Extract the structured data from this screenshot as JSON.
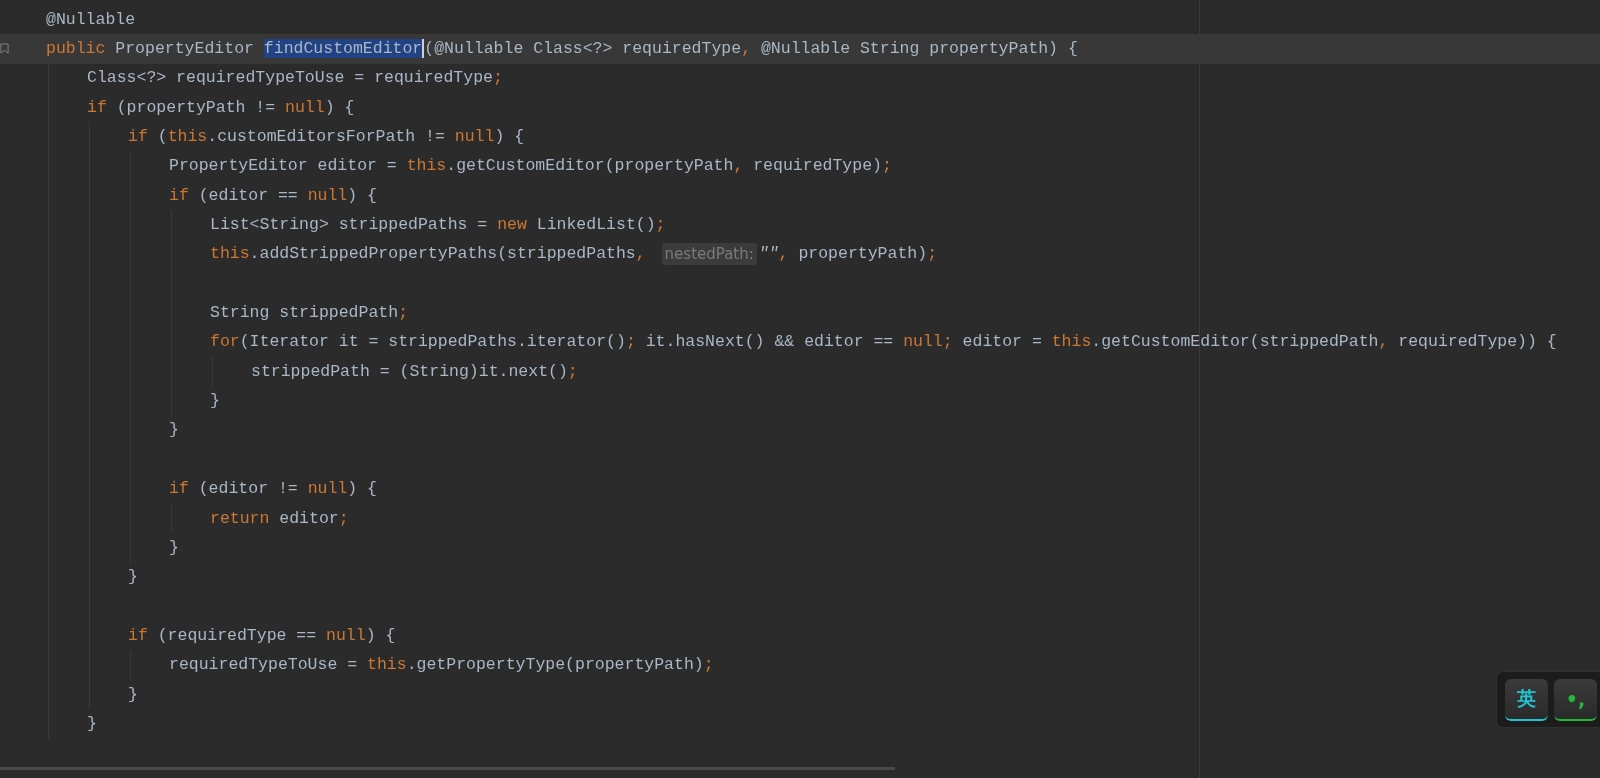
{
  "editor": {
    "lines": [
      {
        "kind": "code",
        "current": false,
        "marker": false,
        "segs": [
          {
            "t": "@Nullable",
            "kind": "plain"
          }
        ]
      },
      {
        "kind": "code",
        "current": true,
        "marker": true,
        "segs": [
          {
            "t": "public ",
            "kind": "kw"
          },
          {
            "t": "PropertyEditor ",
            "kind": "plain"
          },
          {
            "t": "findCustomEditor",
            "kind": "sel"
          },
          {
            "t": "(@Nullable Class<?> requiredType",
            "kind": "plain"
          },
          {
            "t": ", ",
            "kind": "kw"
          },
          {
            "t": "@Nullable String propertyPath) {",
            "kind": "plain"
          }
        ],
        "children": [
          {
            "kind": "code",
            "current": false,
            "marker": false,
            "segs": [
              {
                "t": "Class<?> requiredTypeToUse = requiredType",
                "kind": "plain"
              },
              {
                "t": ";",
                "kind": "kw"
              }
            ]
          },
          {
            "kind": "code",
            "current": false,
            "marker": false,
            "segs": [
              {
                "t": "if ",
                "kind": "kw"
              },
              {
                "t": "(propertyPath != ",
                "kind": "plain"
              },
              {
                "t": "null",
                "kind": "kw"
              },
              {
                "t": ") {",
                "kind": "plain"
              }
            ],
            "children": [
              {
                "kind": "code",
                "current": false,
                "marker": false,
                "segs": [
                  {
                    "t": "if ",
                    "kind": "kw"
                  },
                  {
                    "t": "(",
                    "kind": "plain"
                  },
                  {
                    "t": "this",
                    "kind": "kw"
                  },
                  {
                    "t": ".customEditorsForPath != ",
                    "kind": "plain"
                  },
                  {
                    "t": "null",
                    "kind": "kw"
                  },
                  {
                    "t": ") {",
                    "kind": "plain"
                  }
                ],
                "children": [
                  {
                    "kind": "code",
                    "current": false,
                    "marker": false,
                    "segs": [
                      {
                        "t": "PropertyEditor editor = ",
                        "kind": "plain"
                      },
                      {
                        "t": "this",
                        "kind": "kw"
                      },
                      {
                        "t": ".getCustomEditor(propertyPath",
                        "kind": "plain"
                      },
                      {
                        "t": ", ",
                        "kind": "kw"
                      },
                      {
                        "t": "requiredType)",
                        "kind": "plain"
                      },
                      {
                        "t": ";",
                        "kind": "kw"
                      }
                    ]
                  },
                  {
                    "kind": "code",
                    "current": false,
                    "marker": false,
                    "segs": [
                      {
                        "t": "if ",
                        "kind": "kw"
                      },
                      {
                        "t": "(editor == ",
                        "kind": "plain"
                      },
                      {
                        "t": "null",
                        "kind": "kw"
                      },
                      {
                        "t": ") {",
                        "kind": "plain"
                      }
                    ],
                    "children": [
                      {
                        "kind": "code",
                        "current": false,
                        "marker": false,
                        "segs": [
                          {
                            "t": "List<String> strippedPaths = ",
                            "kind": "plain"
                          },
                          {
                            "t": "new ",
                            "kind": "kw"
                          },
                          {
                            "t": "LinkedList()",
                            "kind": "plain"
                          },
                          {
                            "t": ";",
                            "kind": "kw"
                          }
                        ]
                      },
                      {
                        "kind": "code",
                        "current": false,
                        "marker": false,
                        "segs": [
                          {
                            "t": "this",
                            "kind": "kw"
                          },
                          {
                            "t": ".addStrippedPropertyPaths(strippedPaths",
                            "kind": "plain"
                          },
                          {
                            "t": ", ",
                            "kind": "kw"
                          },
                          {
                            "t": "nestedPath:",
                            "kind": "hint"
                          },
                          {
                            "t": "\"\"",
                            "kind": "str"
                          },
                          {
                            "t": ", ",
                            "kind": "kw"
                          },
                          {
                            "t": "propertyPath)",
                            "kind": "plain"
                          },
                          {
                            "t": ";",
                            "kind": "kw"
                          }
                        ]
                      },
                      {
                        "kind": "blank"
                      },
                      {
                        "kind": "code",
                        "current": false,
                        "marker": false,
                        "segs": [
                          {
                            "t": "String strippedPath",
                            "kind": "plain"
                          },
                          {
                            "t": ";",
                            "kind": "kw"
                          }
                        ]
                      },
                      {
                        "kind": "code",
                        "current": false,
                        "marker": false,
                        "segs": [
                          {
                            "t": "for",
                            "kind": "kw"
                          },
                          {
                            "t": "(Iterator it = strippedPaths.iterator()",
                            "kind": "plain"
                          },
                          {
                            "t": "; ",
                            "kind": "kw"
                          },
                          {
                            "t": "it.hasNext() && editor == ",
                            "kind": "plain"
                          },
                          {
                            "t": "null",
                            "kind": "kw"
                          },
                          {
                            "t": "; ",
                            "kind": "kw"
                          },
                          {
                            "t": "editor = ",
                            "kind": "plain"
                          },
                          {
                            "t": "this",
                            "kind": "kw"
                          },
                          {
                            "t": ".getCustomEditor(strippedPath",
                            "kind": "plain"
                          },
                          {
                            "t": ", ",
                            "kind": "kw"
                          },
                          {
                            "t": "requiredType)) {",
                            "kind": "plain"
                          }
                        ],
                        "children": [
                          {
                            "kind": "code",
                            "current": false,
                            "marker": false,
                            "segs": [
                              {
                                "t": "strippedPath = (String)it.next()",
                                "kind": "plain"
                              },
                              {
                                "t": ";",
                                "kind": "kw"
                              }
                            ]
                          }
                        ]
                      },
                      {
                        "kind": "code",
                        "current": false,
                        "marker": false,
                        "segs": [
                          {
                            "t": "}",
                            "kind": "plain"
                          }
                        ]
                      }
                    ]
                  },
                  {
                    "kind": "code",
                    "current": false,
                    "marker": false,
                    "segs": [
                      {
                        "t": "}",
                        "kind": "plain"
                      }
                    ]
                  },
                  {
                    "kind": "blank"
                  },
                  {
                    "kind": "code",
                    "current": false,
                    "marker": false,
                    "segs": [
                      {
                        "t": "if ",
                        "kind": "kw"
                      },
                      {
                        "t": "(editor != ",
                        "kind": "plain"
                      },
                      {
                        "t": "null",
                        "kind": "kw"
                      },
                      {
                        "t": ") {",
                        "kind": "plain"
                      }
                    ],
                    "children": [
                      {
                        "kind": "code",
                        "current": false,
                        "marker": false,
                        "segs": [
                          {
                            "t": "return ",
                            "kind": "kw"
                          },
                          {
                            "t": "editor",
                            "kind": "plain"
                          },
                          {
                            "t": ";",
                            "kind": "kw"
                          }
                        ]
                      }
                    ]
                  },
                  {
                    "kind": "code",
                    "current": false,
                    "marker": false,
                    "segs": [
                      {
                        "t": "}",
                        "kind": "plain"
                      }
                    ]
                  }
                ]
              },
              {
                "kind": "code",
                "current": false,
                "marker": false,
                "segs": [
                  {
                    "t": "}",
                    "kind": "plain"
                  }
                ]
              },
              {
                "kind": "blank"
              },
              {
                "kind": "code",
                "current": false,
                "marker": false,
                "segs": [
                  {
                    "t": "if ",
                    "kind": "kw"
                  },
                  {
                    "t": "(requiredType == ",
                    "kind": "plain"
                  },
                  {
                    "t": "null",
                    "kind": "kw"
                  },
                  {
                    "t": ") {",
                    "kind": "plain"
                  }
                ],
                "children": [
                  {
                    "kind": "code",
                    "current": false,
                    "marker": false,
                    "segs": [
                      {
                        "t": "requiredTypeToUse = ",
                        "kind": "plain"
                      },
                      {
                        "t": "this",
                        "kind": "kw"
                      },
                      {
                        "t": ".getPropertyType(propertyPath)",
                        "kind": "plain"
                      },
                      {
                        "t": ";",
                        "kind": "kw"
                      }
                    ]
                  }
                ]
              },
              {
                "kind": "code",
                "current": false,
                "marker": false,
                "segs": [
                  {
                    "t": "}",
                    "kind": "plain"
                  }
                ]
              }
            ]
          },
          {
            "kind": "code",
            "current": false,
            "marker": false,
            "segs": [
              {
                "t": "}",
                "kind": "plain"
              }
            ]
          }
        ]
      }
    ]
  },
  "ime_bar": {
    "keys": [
      {
        "label": "英",
        "color": "#22c4d0"
      },
      {
        "label": "•,",
        "color": "#22b83a"
      }
    ]
  }
}
